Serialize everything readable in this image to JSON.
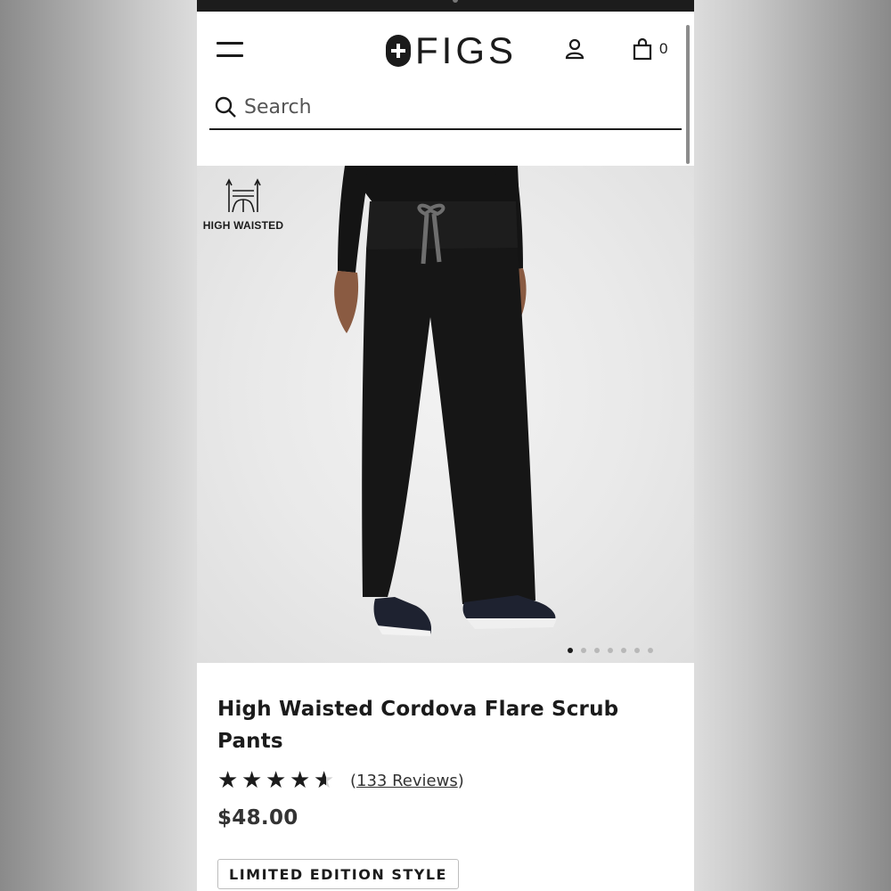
{
  "header": {
    "brand": "FIGS",
    "cart_count": "0",
    "account_icon": "user-icon",
    "cart_icon": "shopping-bag-icon",
    "menu_icon": "hamburger-menu-icon"
  },
  "search": {
    "placeholder": "Search",
    "icon": "search-icon"
  },
  "gallery": {
    "badge_label": "HIGH WAISTED",
    "badge_icon": "high-waist-icon",
    "total_images": 7,
    "active_index": 0
  },
  "product": {
    "title": "High Waisted Cordova Flare Scrub Pants",
    "rating": 4.5,
    "reviews_label": "133 Reviews",
    "price": "$48.00",
    "tag": "LIMITED EDITION STYLE"
  },
  "colors": {
    "text": "#1b1b1b",
    "background": "#ffffff",
    "image_bg": "#e9e9e9",
    "drawstring": "#6e6e6e"
  }
}
